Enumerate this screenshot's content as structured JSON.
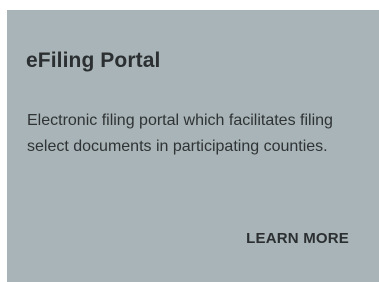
{
  "card": {
    "title": "eFiling Portal",
    "description": "Electronic filing portal which facilitates filing select documents in participating counties.",
    "link_label": "LEARN MORE",
    "background_color": "#a8b4b7"
  }
}
